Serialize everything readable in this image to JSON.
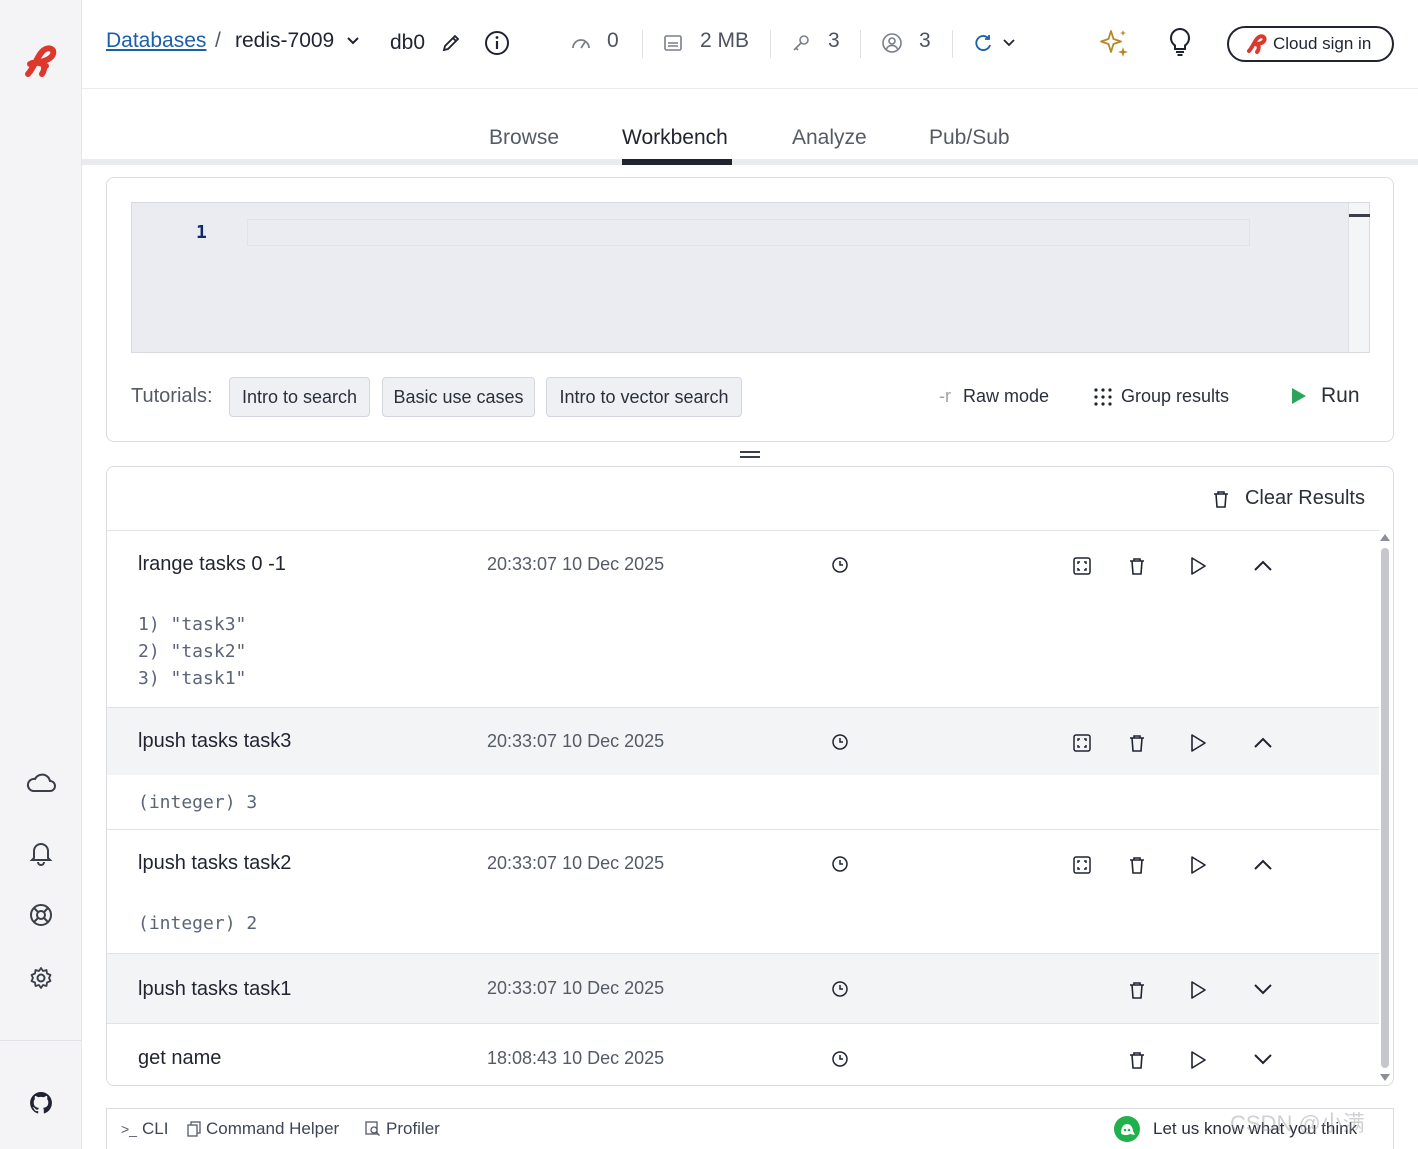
{
  "header": {
    "breadcrumb_link": "Databases",
    "breadcrumb_sep": "/",
    "database_name": "redis-7009",
    "db_index": "db0",
    "stats": {
      "commands_per_sec": "0",
      "memory": "2 MB",
      "keys": "3",
      "clients": "3"
    },
    "cloud_button": "Cloud sign in"
  },
  "tabs": [
    {
      "label": "Browse"
    },
    {
      "label": "Workbench",
      "active": true
    },
    {
      "label": "Analyze"
    },
    {
      "label": "Pub/Sub"
    }
  ],
  "editor": {
    "line_number": "1",
    "tutorials_label": "Tutorials:",
    "tutorials": [
      "Intro to search",
      "Basic use cases",
      "Intro to vector search"
    ],
    "raw_mode_icon": "-r",
    "raw_mode": "Raw mode",
    "group_results": "Group results",
    "run": "Run"
  },
  "results": {
    "clear_label": "Clear Results",
    "items": [
      {
        "command": "lrange tasks 0 -1",
        "time": "20:33:07 10 Dec 2025",
        "output": "1) \"task3\"\n2) \"task2\"\n3) \"task1\"",
        "expanded": true
      },
      {
        "command": "lpush tasks task3",
        "time": "20:33:07 10 Dec 2025",
        "output": "(integer) 3",
        "expanded": true
      },
      {
        "command": "lpush tasks task2",
        "time": "20:33:07 10 Dec 2025",
        "output": "(integer) 2",
        "expanded": true
      },
      {
        "command": "lpush tasks task1",
        "time": "20:33:07 10 Dec 2025",
        "output": "",
        "expanded": false
      },
      {
        "command": "get name",
        "time": "18:08:43 10 Dec 2025",
        "output": "",
        "expanded": false
      }
    ]
  },
  "bottom_bar": {
    "cli": "CLI",
    "cli_icon": ">_",
    "command_helper": "Command Helper",
    "profiler": "Profiler",
    "feedback": "Let us know what you think"
  },
  "watermark": "CSDN @小满",
  "colors": {
    "brand_red": "#dc382c",
    "link_blue": "#1b5fa8",
    "run_green": "#2aa55b",
    "feedback_green": "#21b14b"
  }
}
